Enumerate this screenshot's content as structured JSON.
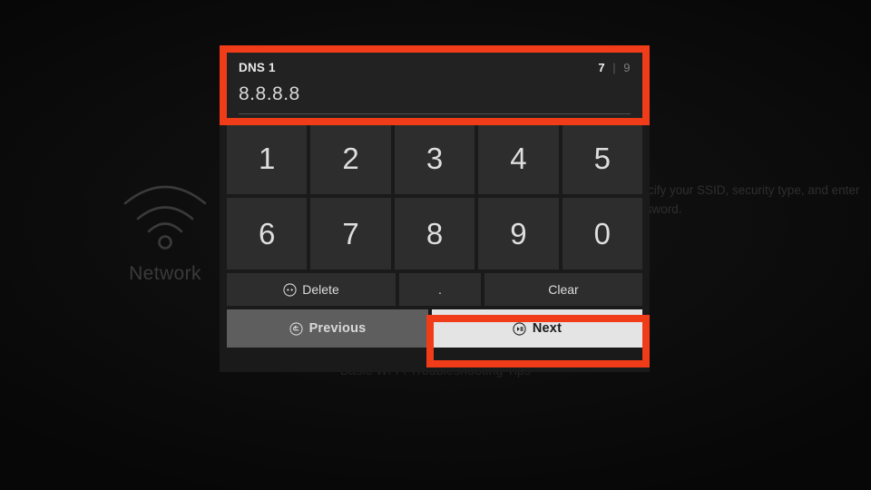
{
  "background": {
    "wifi_icon": "wifi-icon",
    "wifi_label": "Network",
    "description": "Specify your SSID, security type, and enter password.",
    "footnote": "Basic Wi-Fi Troubleshooting Tips"
  },
  "dialog": {
    "field": {
      "label": "DNS 1",
      "value": "8.8.8.8",
      "step_current": "7",
      "step_separator": "|",
      "step_total": "9"
    },
    "keypad": {
      "rows": [
        [
          "1",
          "2",
          "3",
          "4",
          "5"
        ],
        [
          "6",
          "7",
          "8",
          "9",
          "0"
        ]
      ]
    },
    "actions": {
      "delete_label": "Delete",
      "delete_icon": "circle-dots-icon",
      "dot_label": ".",
      "clear_label": "Clear"
    },
    "nav": {
      "previous_label": "Previous",
      "previous_icon": "circle-back-arrow-icon",
      "next_label": "Next",
      "next_icon": "circle-play-pause-icon"
    }
  },
  "colors": {
    "highlight": "#f03c18",
    "panel_bg": "#1a1a1a",
    "key_bg": "#2d2d2d",
    "next_bg": "#e4e4e4",
    "previous_bg": "#5e5e5e"
  }
}
